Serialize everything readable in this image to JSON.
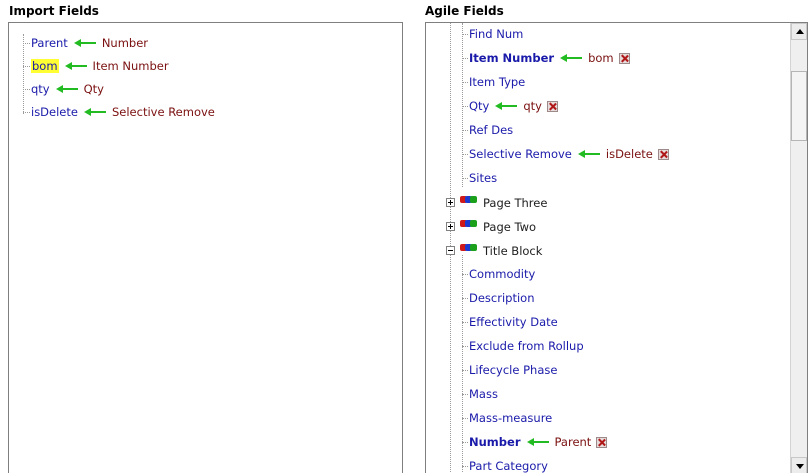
{
  "import_panel": {
    "title": "Import Fields",
    "items": [
      {
        "name": "Parent",
        "mapped_to": "Number"
      },
      {
        "name": "bom",
        "mapped_to": "Item Number"
      },
      {
        "name": "qty",
        "mapped_to": "Qty"
      },
      {
        "name": "isDelete",
        "mapped_to": "Selective Remove"
      }
    ]
  },
  "agile_panel": {
    "title": "Agile Fields",
    "fields_top": [
      {
        "name": "Find Num"
      },
      {
        "name": "Item Number",
        "mapped_from": "bom"
      },
      {
        "name": "Item Type"
      },
      {
        "name": "Qty",
        "mapped_from": "qty"
      },
      {
        "name": "Ref Des"
      },
      {
        "name": "Selective Remove",
        "mapped_from": "isDelete"
      },
      {
        "name": "Sites"
      }
    ],
    "groups": [
      {
        "name": "Page Three",
        "state": "collapsed"
      },
      {
        "name": "Page Two",
        "state": "collapsed"
      },
      {
        "name": "Title Block",
        "state": "expanded"
      }
    ],
    "fields_title_block": [
      {
        "name": "Commodity"
      },
      {
        "name": "Description"
      },
      {
        "name": "Effectivity Date"
      },
      {
        "name": "Exclude from Rollup"
      },
      {
        "name": "Lifecycle Phase"
      },
      {
        "name": "Mass"
      },
      {
        "name": "Mass-measure"
      },
      {
        "name": "Number",
        "mapped_from": "Parent"
      },
      {
        "name": "Part Category"
      }
    ]
  },
  "colors": {
    "field_text": "#1a1aaa",
    "mapped_text": "#7a1010",
    "arrow": "#22bb22",
    "highlight": "#ffff33"
  }
}
